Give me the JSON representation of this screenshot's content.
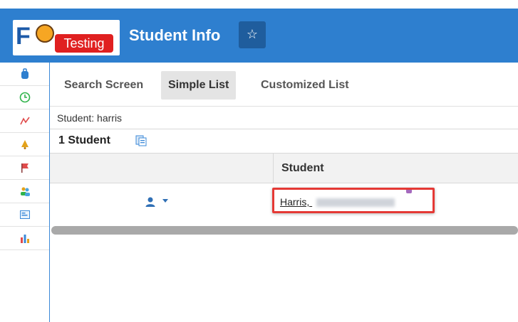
{
  "header": {
    "logo_text": "F",
    "logo_badge": "Testing",
    "title": "Student Info",
    "star_icon": "star-icon"
  },
  "sidebar": {
    "items": [
      {
        "icon": "backpack-icon",
        "color": "#2e7fcf"
      },
      {
        "icon": "clock-icon",
        "color": "#2fb34a"
      },
      {
        "icon": "grades-icon",
        "color": "#e04b4b"
      },
      {
        "icon": "bell-icon",
        "color": "#e3a21a"
      },
      {
        "icon": "flag-icon",
        "color": "#e04b4b"
      },
      {
        "icon": "users-icon",
        "color": "#4aa3df"
      },
      {
        "icon": "form-icon",
        "color": "#3b89d8"
      },
      {
        "icon": "bar-chart-icon",
        "color": "#3b89d8"
      }
    ]
  },
  "tabs": [
    {
      "label": "Search Screen",
      "active": false
    },
    {
      "label": "Simple List",
      "active": true
    },
    {
      "label": "Customized List",
      "active": false
    }
  ],
  "search_label": "Student: harris",
  "count_label": "1 Student",
  "table": {
    "columns": [
      "",
      "Student"
    ],
    "rows": [
      {
        "student": "Harris, "
      }
    ]
  },
  "colors": {
    "header": "#2e7fcf",
    "badge": "#e02020",
    "highlight": "#e53935"
  }
}
